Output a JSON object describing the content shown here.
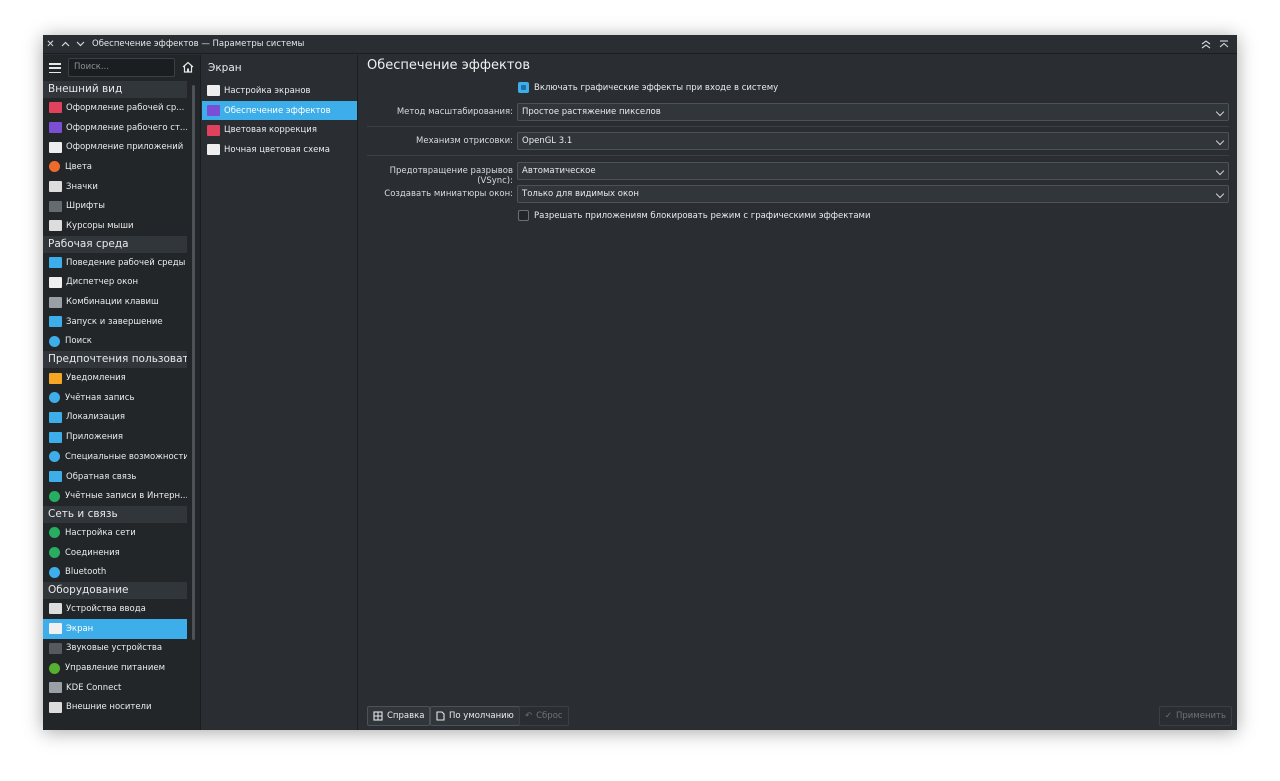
{
  "window": {
    "title": "Обеспечение эффектов — Параметры системы"
  },
  "sidebar": {
    "search_placeholder": "Поиск...",
    "categories": [
      {
        "label": "Внешний вид",
        "items": [
          {
            "label": "Оформление рабочей ср...",
            "icon": "appearance-icon",
            "color": "#e0425e"
          },
          {
            "label": "Оформление рабочего ст...",
            "icon": "desktop-theme-icon",
            "color": "#7a4fd6"
          },
          {
            "label": "Оформление приложений",
            "icon": "brush-icon",
            "color": "#eeeeee"
          },
          {
            "label": "Цвета",
            "icon": "colors-icon",
            "color": "#f06a2c"
          },
          {
            "label": "Значки",
            "icon": "icons-icon",
            "color": "#dddddd"
          },
          {
            "label": "Шрифты",
            "icon": "fonts-icon",
            "color": "#666b70"
          },
          {
            "label": "Курсоры мыши",
            "icon": "cursor-icon",
            "color": "#dddddd"
          }
        ]
      },
      {
        "label": "Рабочая среда",
        "items": [
          {
            "label": "Поведение рабочей среды",
            "icon": "workspace-icon",
            "color": "#3daee9"
          },
          {
            "label": "Диспетчер окон",
            "icon": "window-manager-icon",
            "color": "#f0f0f0"
          },
          {
            "label": "Комбинации клавиш",
            "icon": "keyboard-icon",
            "color": "#9aa0a6"
          },
          {
            "label": "Запуск и завершение",
            "icon": "startup-icon",
            "color": "#3daee9"
          },
          {
            "label": "Поиск",
            "icon": "search-icon",
            "color": "#3daee9"
          }
        ]
      },
      {
        "label": "Предпочтения пользователя",
        "items": [
          {
            "label": "Уведомления",
            "icon": "bell-icon",
            "color": "#f5a623"
          },
          {
            "label": "Учётная запись",
            "icon": "user-icon",
            "color": "#3daee9"
          },
          {
            "label": "Локализация",
            "icon": "locale-icon",
            "color": "#3daee9"
          },
          {
            "label": "Приложения",
            "icon": "applications-icon",
            "color": "#3daee9"
          },
          {
            "label": "Специальные возможности",
            "icon": "accessibility-icon",
            "color": "#3daee9"
          },
          {
            "label": "Обратная связь",
            "icon": "feedback-icon",
            "color": "#3daee9"
          },
          {
            "label": "Учётные записи в Интерн...",
            "icon": "online-accounts-icon",
            "color": "#27ae60"
          }
        ]
      },
      {
        "label": "Сеть и связь",
        "items": [
          {
            "label": "Настройка сети",
            "icon": "network-icon",
            "color": "#27ae60"
          },
          {
            "label": "Соединения",
            "icon": "connections-icon",
            "color": "#27ae60"
          },
          {
            "label": "Bluetooth",
            "icon": "bluetooth-icon",
            "color": "#3daee9"
          }
        ]
      },
      {
        "label": "Оборудование",
        "items": [
          {
            "label": "Устройства ввода",
            "icon": "input-devices-icon",
            "color": "#dddddd"
          },
          {
            "label": "Экран",
            "icon": "display-icon",
            "color": "#f0f0f0",
            "selected": true
          },
          {
            "label": "Звуковые устройства",
            "icon": "audio-icon",
            "color": "#555a5f"
          },
          {
            "label": "Управление питанием",
            "icon": "power-icon",
            "color": "#55b02f"
          },
          {
            "label": "KDE Connect",
            "icon": "phone-icon",
            "color": "#9aa0a6"
          },
          {
            "label": "Внешние носители",
            "icon": "usb-icon",
            "color": "#dddddd"
          }
        ]
      }
    ]
  },
  "middle": {
    "title": "Экран",
    "items": [
      {
        "label": "Настройка экранов",
        "icon": "monitor-icon",
        "color": "#eeeeee"
      },
      {
        "label": "Обеспечение эффектов",
        "icon": "compositor-icon",
        "color": "#7a4fd6",
        "selected": true
      },
      {
        "label": "Цветовая коррекция",
        "icon": "color-correction-icon",
        "color": "#e0425e"
      },
      {
        "label": "Ночная цветовая схема",
        "icon": "night-color-icon",
        "color": "#eeeeee"
      }
    ]
  },
  "main": {
    "title": "Обеспечение эффектов",
    "enable_effects": {
      "label": "Включать графические эффекты при входе в систему",
      "checked": true
    },
    "scaling": {
      "label": "Метод масштабирования:",
      "value": "Простое растяжение пикселов"
    },
    "backend": {
      "label": "Механизм отрисовки:",
      "value": "OpenGL 3.1"
    },
    "vsync": {
      "label": "Предотвращение разрывов (VSync):",
      "value": "Автоматическое"
    },
    "thumbnails": {
      "label": "Создавать миниатюры окон:",
      "value": "Только для видимых окон"
    },
    "allow_block": {
      "label": "Разрешать приложениям блокировать режим с графическими эффектами",
      "checked": false
    }
  },
  "buttons": {
    "help": "Справка",
    "defaults": "По умолчанию",
    "reset": "Сброс",
    "apply": "Применить"
  }
}
